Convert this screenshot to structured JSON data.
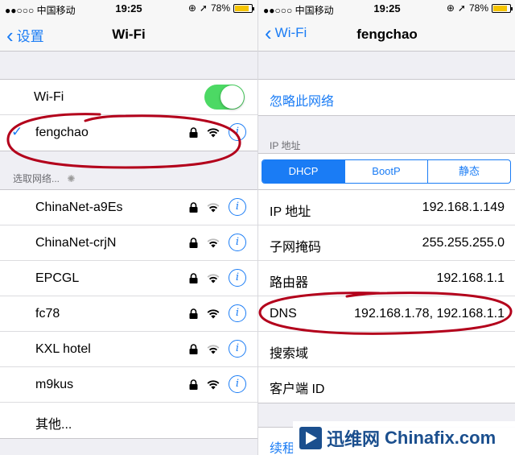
{
  "left": {
    "status": {
      "carrier": "●●○○○ 中国移动",
      "time": "19:25",
      "battery": "78%",
      "battery_level": 0.78
    },
    "nav": {
      "back_label": "设置",
      "title": "Wi-Fi"
    },
    "wifi_toggle": {
      "label": "Wi-Fi",
      "on": true
    },
    "connected": {
      "name": "fengchao"
    },
    "section_header": "选取网络...",
    "networks": [
      {
        "name": "ChinaNet-a9Es"
      },
      {
        "name": "ChinaNet-crjN"
      },
      {
        "name": "EPCGL"
      },
      {
        "name": "fc78"
      },
      {
        "name": "KXL hotel"
      },
      {
        "name": "m9kus"
      }
    ],
    "other_label": "其他..."
  },
  "right": {
    "status": {
      "carrier": "●●○○○ 中国移动",
      "time": "19:25",
      "battery": "78%",
      "battery_level": 0.78
    },
    "nav": {
      "back_label": "Wi-Fi",
      "title": "fengchao"
    },
    "forget_label": "忽略此网络",
    "ip_header": "IP 地址",
    "segments": [
      "DHCP",
      "BootP",
      "静态"
    ],
    "fields": [
      {
        "label": "IP 地址",
        "value": "192.168.1.149"
      },
      {
        "label": "子网掩码",
        "value": "255.255.255.0"
      },
      {
        "label": "路由器",
        "value": "192.168.1.1"
      },
      {
        "label": "DNS",
        "value": "192.168.1.78, 192.168.1.1"
      },
      {
        "label": "搜索域",
        "value": ""
      },
      {
        "label": "客户端 ID",
        "value": ""
      }
    ],
    "renew_label": "续租"
  },
  "watermark": {
    "cn": "迅维网",
    "en": "Chinafix.com"
  },
  "colors": {
    "accent": "#1a7cf5",
    "switch_on": "#4cd964",
    "annotation": "#b3001b"
  }
}
